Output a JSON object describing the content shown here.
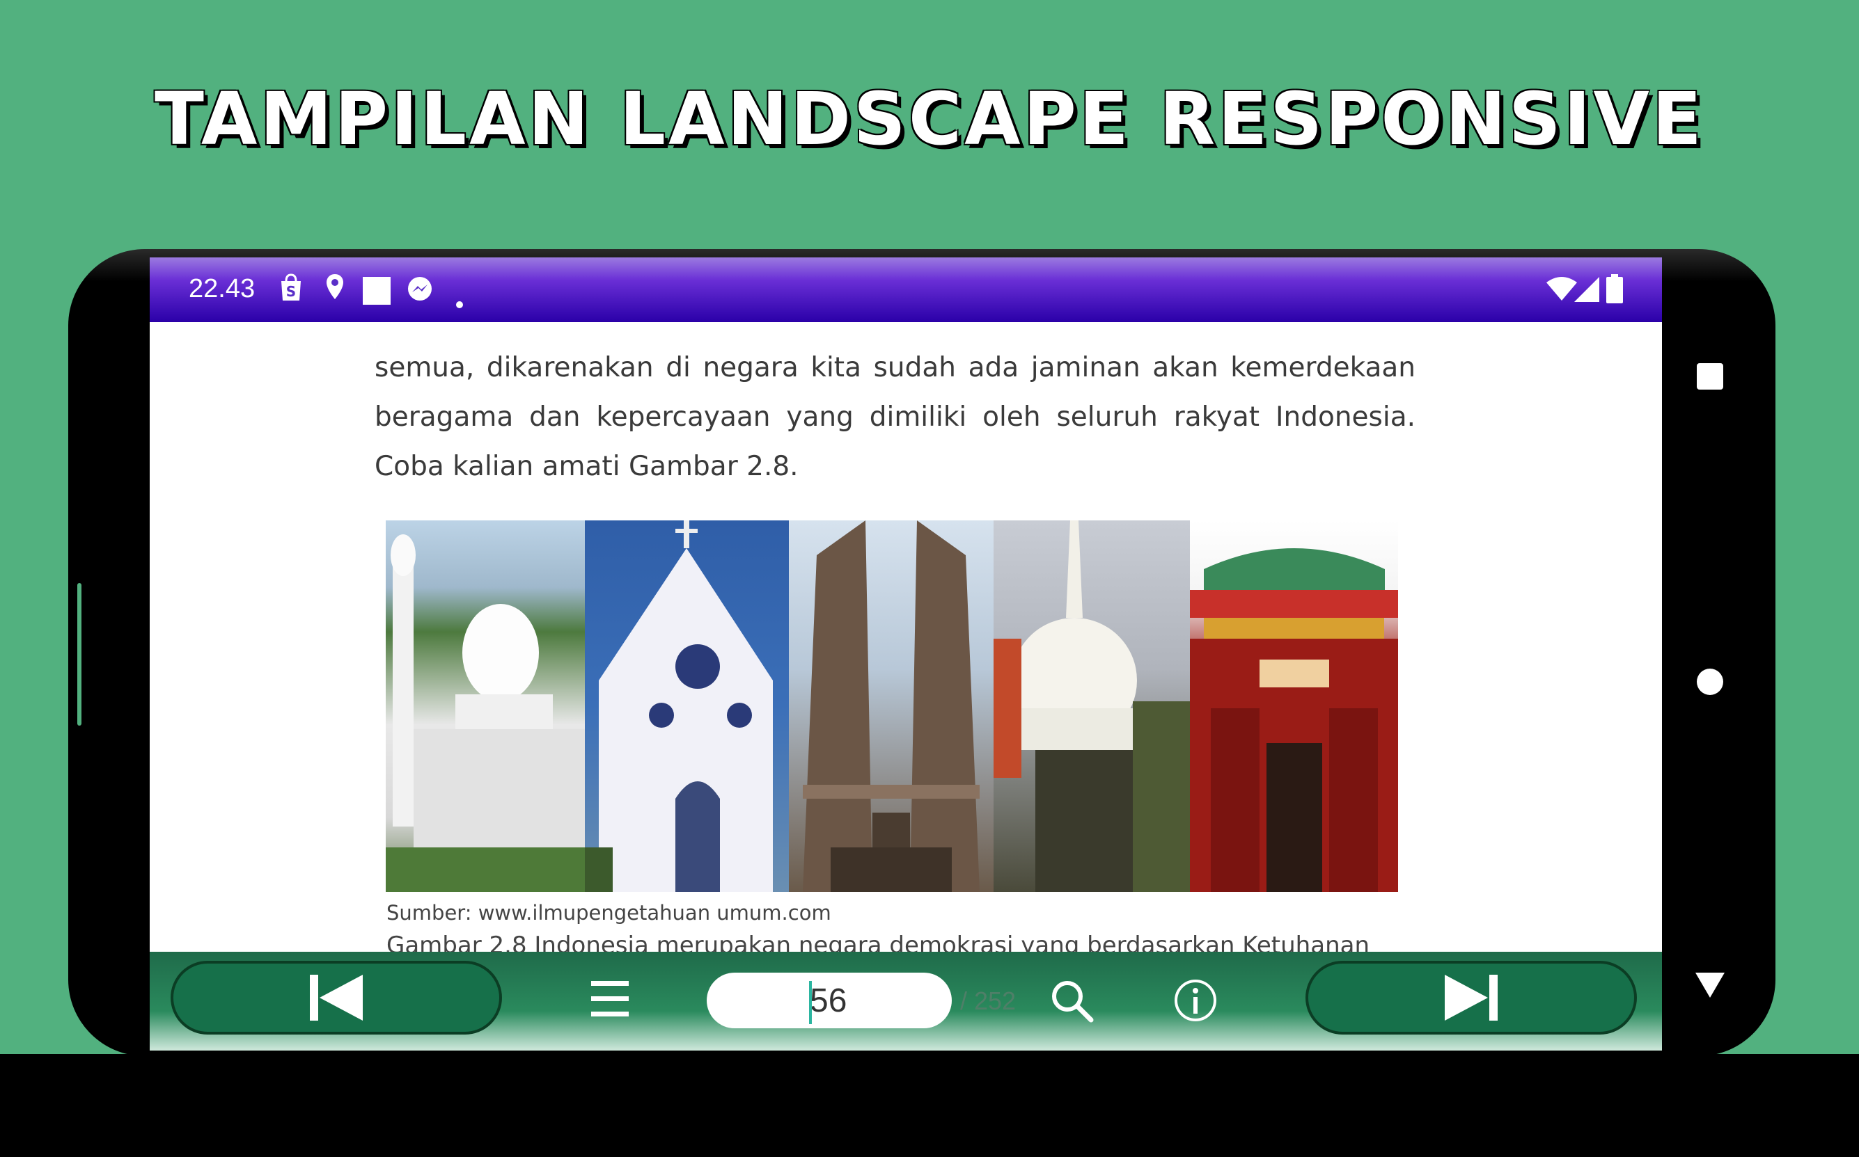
{
  "headline": "TAMPILAN LANDSCAPE RESPONSIVE",
  "status_bar": {
    "time": "22.43",
    "left_icons": [
      "shopee-bag-icon",
      "location-pin-icon",
      "square-notification-icon",
      "messenger-icon",
      "dot-icon"
    ],
    "right_icons": [
      "wifi-icon",
      "signal-icon",
      "battery-icon"
    ]
  },
  "page": {
    "paragraph": "semua, dikarenakan di negara kita sudah ada jaminan akan kemerdekaan beragama dan kepercayaan yang dimiliki oleh seluruh rakyat Indonesia. Coba kalian amati Gambar 2.8.",
    "figure_panels": [
      "mosque",
      "church",
      "temple-gate",
      "stupa",
      "chinese-temple"
    ],
    "source": "Sumber: www.ilmupengetahuan umum.com",
    "caption": "Gambar 2.8 Indonesia merupakan negara demokrasi yang berdasarkan Ketuhanan"
  },
  "toolbar": {
    "prev_icon": "skip-previous-icon",
    "menu_icon": "menu-icon",
    "page_value": "56",
    "total_pages": "/ 252",
    "search_icon": "search-icon",
    "info_icon": "info-icon",
    "next_icon": "skip-next-icon"
  },
  "system_nav": {
    "icons": [
      "recents-square-icon",
      "home-circle-icon",
      "back-triangle-icon"
    ]
  },
  "colors": {
    "background": "#52b17f",
    "status_bar": "#2a00a8",
    "toolbar": "#1f6b4a",
    "nav_button": "#16704a"
  }
}
